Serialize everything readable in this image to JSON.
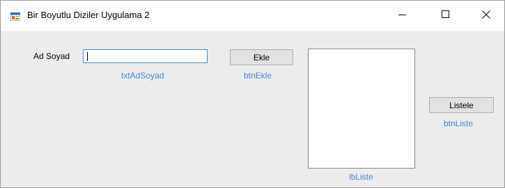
{
  "window": {
    "title": "Bir Boyutlu Diziler Uygulama 2",
    "app_icon": "winforms-app-icon",
    "controls": {
      "minimize": "minimize-icon",
      "maximize": "maximize-icon",
      "close": "close-icon"
    }
  },
  "form": {
    "name_label": "Ad Soyad",
    "name_input": {
      "value": "",
      "placeholder": ""
    },
    "name_input_id_label": "txtAdSoyad",
    "add_button": "Ekle",
    "add_button_id_label": "btnEkle",
    "listbox_items": [],
    "listbox_id_label": "lbListe",
    "list_button": "Listele",
    "list_button_id_label": "btnListe"
  },
  "colors": {
    "designer_label": "#3d84d8",
    "focus_border": "#3f8bd9",
    "button_face": "#e1e1e1"
  }
}
